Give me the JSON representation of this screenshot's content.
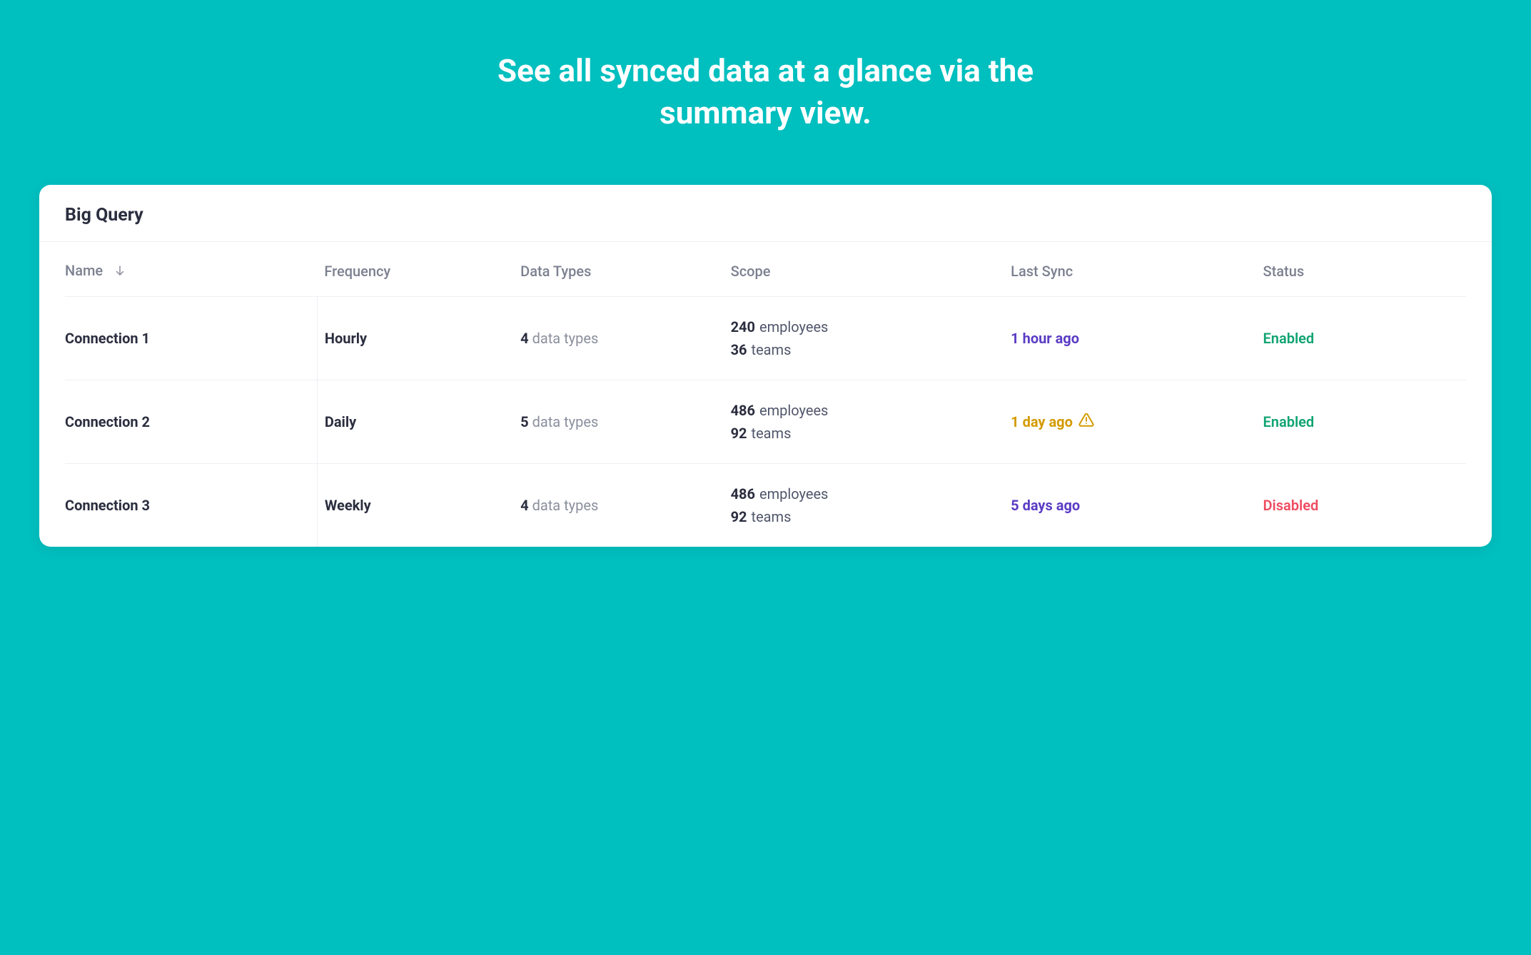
{
  "hero": {
    "heading": "See all synced data at a glance via the summary view."
  },
  "card": {
    "title": "Big Query",
    "columns": {
      "name": "Name",
      "frequency": "Frequency",
      "data_types": "Data Types",
      "scope": "Scope",
      "last_sync": "Last Sync",
      "status": "Status"
    },
    "sort": {
      "column": "name",
      "direction": "desc"
    },
    "labels": {
      "data_types_suffix": "data types",
      "employees": "employees",
      "teams": "teams"
    },
    "rows": [
      {
        "name": "Connection 1",
        "frequency": "Hourly",
        "data_types_count": "4",
        "scope": {
          "employees": "240",
          "teams": "36"
        },
        "last_sync": {
          "text": "1 hour ago",
          "tone": "purple",
          "warning": false
        },
        "status": {
          "text": "Enabled",
          "kind": "enabled"
        }
      },
      {
        "name": "Connection 2",
        "frequency": "Daily",
        "data_types_count": "5",
        "scope": {
          "employees": "486",
          "teams": "92"
        },
        "last_sync": {
          "text": "1 day ago",
          "tone": "amber",
          "warning": true
        },
        "status": {
          "text": "Enabled",
          "kind": "enabled"
        }
      },
      {
        "name": "Connection 3",
        "frequency": "Weekly",
        "data_types_count": "4",
        "scope": {
          "employees": "486",
          "teams": "92"
        },
        "last_sync": {
          "text": "5 days ago",
          "tone": "purple",
          "warning": false
        },
        "status": {
          "text": "Disabled",
          "kind": "disabled"
        }
      }
    ]
  },
  "colors": {
    "background": "#00bfbf",
    "purple": "#5b3cc4",
    "amber": "#d39a00",
    "enabled": "#0ea371",
    "disabled": "#ef4a5f"
  }
}
